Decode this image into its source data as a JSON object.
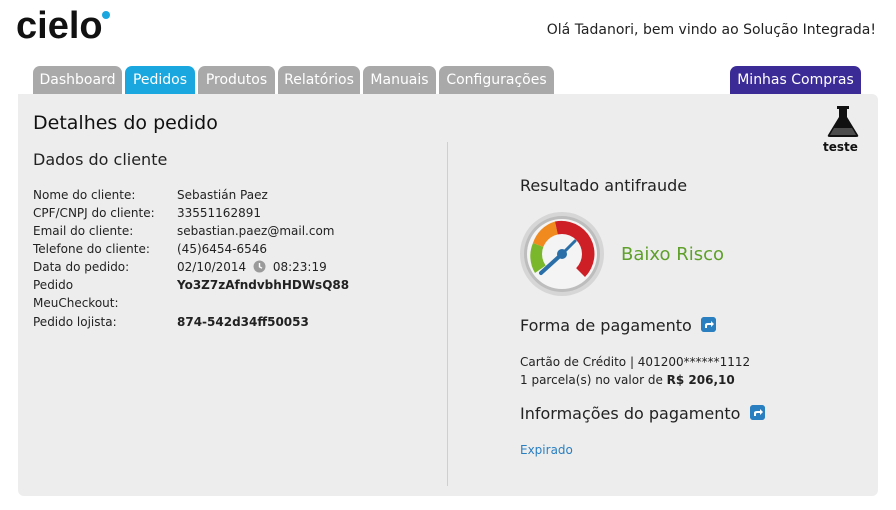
{
  "header": {
    "brand": "cielo",
    "welcome": "Olá Tadanori, bem vindo ao Solução Integrada!"
  },
  "tabs": [
    {
      "label": "Dashboard"
    },
    {
      "label": "Pedidos",
      "active": true
    },
    {
      "label": "Produtos"
    },
    {
      "label": "Relatórios"
    },
    {
      "label": "Manuais"
    },
    {
      "label": "Configurações"
    }
  ],
  "minhas_compras": "Minhas Compras",
  "test_badge": "teste",
  "page_title": "Detalhes do pedido",
  "cliente": {
    "heading": "Dados do cliente",
    "fields": [
      {
        "label": "Nome do cliente:",
        "value": "Sebastián Paez"
      },
      {
        "label": "CPF/CNPJ do cliente:",
        "value": "33551162891"
      },
      {
        "label": "Email do cliente:",
        "value": "sebastian.paez@mail.com"
      },
      {
        "label": "Telefone do cliente:",
        "value": "(45)6454-6546"
      },
      {
        "label": "Data do pedido:",
        "date": "02/10/2014",
        "time": "08:23:19"
      },
      {
        "label": "Pedido",
        "value": "Yo3Z7zAfndvbhHDWsQ88"
      },
      {
        "label": "MeuCheckout:",
        "value": ""
      },
      {
        "label": "Pedido lojista:",
        "value": "874-542d34ff50053"
      }
    ]
  },
  "antifraude": {
    "heading": "Resultado antifraude",
    "result": "Baixo Risco",
    "result_color": "#5ea02a"
  },
  "pagamento": {
    "heading": "Forma de pagamento",
    "card_line": "Cartão de Crédito | 401200******1112",
    "installments_prefix": "1 parcela(s) no valor de",
    "installments_value": "R$ 206,10"
  },
  "info_pagamento": {
    "heading": "Informações do pagamento",
    "status": "Expirado"
  },
  "colors": {
    "tab_gray": "#a9a9a9",
    "tab_active": "#1aa7e0",
    "tab_purple": "#3b2b97",
    "link_blue": "#2a7fc1"
  }
}
